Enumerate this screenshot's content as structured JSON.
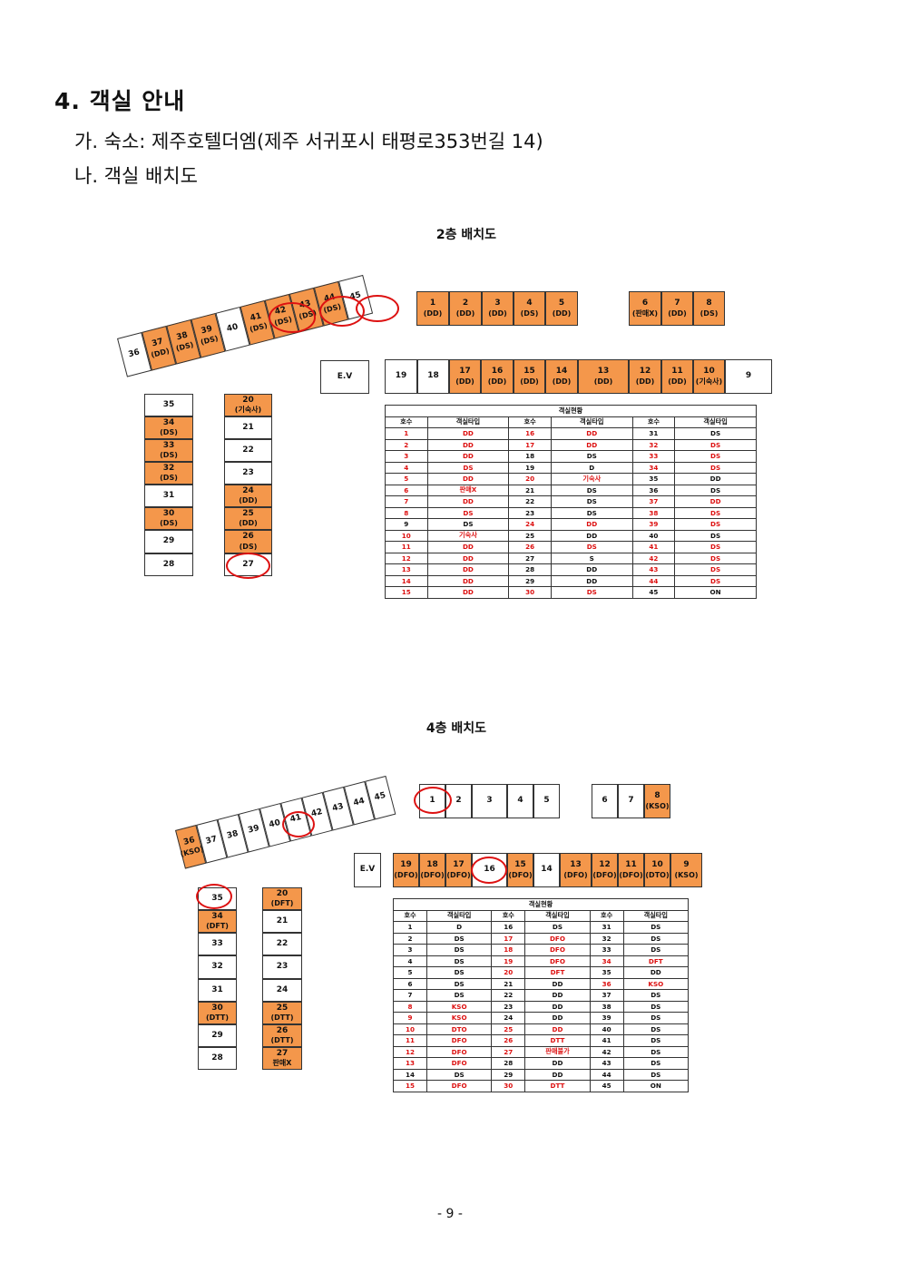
{
  "heading": "4. 객실 안내",
  "lines": [
    "가. 숙소: 제주호텔더엠(제주 서귀포시 태평로353번길 14)",
    "나. 객실 배치도"
  ],
  "floor2": {
    "title": "2층 배치도",
    "ev": "E.V",
    "table": {
      "caption": "객실현황",
      "headers": [
        "호수",
        "객실타입",
        "호수",
        "객실타입",
        "호수",
        "객실타입"
      ],
      "rows": [
        [
          "1",
          "DD",
          "16",
          "DD",
          "31",
          "DS"
        ],
        [
          "2",
          "DD",
          "17",
          "DD",
          "32",
          "DS"
        ],
        [
          "3",
          "DD",
          "18",
          "DS",
          "33",
          "DS"
        ],
        [
          "4",
          "DS",
          "19",
          "D",
          "34",
          "DS"
        ],
        [
          "5",
          "DD",
          "20",
          "기숙사",
          "35",
          "DD"
        ],
        [
          "6",
          "판매X",
          "21",
          "DS",
          "36",
          "DS"
        ],
        [
          "7",
          "DD",
          "22",
          "DS",
          "37",
          "DD"
        ],
        [
          "8",
          "DS",
          "23",
          "DS",
          "38",
          "DS"
        ],
        [
          "9",
          "DS",
          "24",
          "DD",
          "39",
          "DS"
        ],
        [
          "10",
          "기숙사",
          "25",
          "DD",
          "40",
          "DS"
        ],
        [
          "11",
          "DD",
          "26",
          "DS",
          "41",
          "DS"
        ],
        [
          "12",
          "DD",
          "27",
          "S",
          "42",
          "DS"
        ],
        [
          "13",
          "DD",
          "28",
          "DD",
          "43",
          "DS"
        ],
        [
          "14",
          "DD",
          "29",
          "DD",
          "44",
          "DS"
        ],
        [
          "15",
          "DD",
          "30",
          "DS",
          "45",
          "ON"
        ]
      ],
      "red": [
        [
          1,
          1,
          1,
          1,
          0,
          0
        ],
        [
          1,
          1,
          1,
          1,
          1,
          1
        ],
        [
          1,
          1,
          0,
          0,
          1,
          1
        ],
        [
          1,
          1,
          0,
          0,
          1,
          1
        ],
        [
          1,
          1,
          1,
          1,
          0,
          0
        ],
        [
          1,
          1,
          0,
          0,
          0,
          0
        ],
        [
          1,
          1,
          0,
          0,
          1,
          1
        ],
        [
          1,
          1,
          0,
          0,
          1,
          1
        ],
        [
          0,
          0,
          1,
          1,
          1,
          1
        ],
        [
          1,
          1,
          0,
          0,
          0,
          0
        ],
        [
          1,
          1,
          1,
          1,
          1,
          1
        ],
        [
          1,
          1,
          0,
          0,
          1,
          1
        ],
        [
          1,
          1,
          0,
          0,
          1,
          1
        ],
        [
          1,
          1,
          0,
          0,
          1,
          1
        ],
        [
          1,
          1,
          1,
          1,
          0,
          0
        ]
      ]
    }
  },
  "floor4": {
    "title": "4층 배치도",
    "ev": "E.V",
    "table": {
      "caption": "객실현황",
      "headers": [
        "호수",
        "객실타입",
        "호수",
        "객실타입",
        "호수",
        "객실타입"
      ],
      "rows": [
        [
          "1",
          "D",
          "16",
          "DS",
          "31",
          "DS"
        ],
        [
          "2",
          "DS",
          "17",
          "DFO",
          "32",
          "DS"
        ],
        [
          "3",
          "DS",
          "18",
          "DFO",
          "33",
          "DS"
        ],
        [
          "4",
          "DS",
          "19",
          "DFO",
          "34",
          "DFT"
        ],
        [
          "5",
          "DS",
          "20",
          "DFT",
          "35",
          "DD"
        ],
        [
          "6",
          "DS",
          "21",
          "DD",
          "36",
          "KSO"
        ],
        [
          "7",
          "DS",
          "22",
          "DD",
          "37",
          "DS"
        ],
        [
          "8",
          "KSO",
          "23",
          "DD",
          "38",
          "DS"
        ],
        [
          "9",
          "KSO",
          "24",
          "DD",
          "39",
          "DS"
        ],
        [
          "10",
          "DTO",
          "25",
          "DD",
          "40",
          "DS"
        ],
        [
          "11",
          "DFO",
          "26",
          "DTT",
          "41",
          "DS"
        ],
        [
          "12",
          "DFO",
          "27",
          "판매불가",
          "42",
          "DS"
        ],
        [
          "13",
          "DFO",
          "28",
          "DD",
          "43",
          "DS"
        ],
        [
          "14",
          "DS",
          "29",
          "DD",
          "44",
          "DS"
        ],
        [
          "15",
          "DFO",
          "30",
          "DTT",
          "45",
          "ON"
        ]
      ],
      "red": [
        [
          0,
          0,
          0,
          0,
          0,
          0
        ],
        [
          0,
          0,
          1,
          1,
          0,
          0
        ],
        [
          0,
          0,
          1,
          1,
          0,
          0
        ],
        [
          0,
          0,
          1,
          1,
          1,
          1
        ],
        [
          0,
          0,
          1,
          1,
          0,
          0
        ],
        [
          0,
          0,
          0,
          0,
          1,
          1
        ],
        [
          0,
          0,
          0,
          0,
          0,
          0
        ],
        [
          1,
          1,
          0,
          0,
          0,
          0
        ],
        [
          1,
          1,
          0,
          0,
          0,
          0
        ],
        [
          1,
          1,
          1,
          1,
          0,
          0
        ],
        [
          1,
          1,
          1,
          1,
          0,
          0
        ],
        [
          1,
          1,
          1,
          1,
          0,
          0
        ],
        [
          1,
          1,
          0,
          0,
          0,
          0
        ],
        [
          0,
          0,
          0,
          0,
          0,
          0
        ],
        [
          1,
          1,
          1,
          1,
          0,
          0
        ]
      ]
    }
  },
  "page_number": "- 9 -"
}
